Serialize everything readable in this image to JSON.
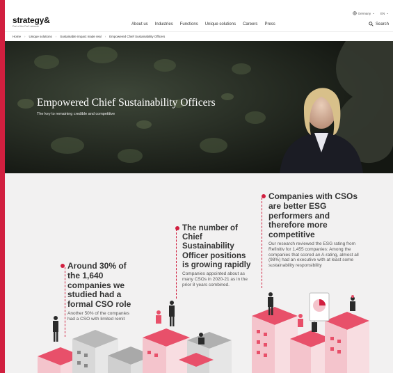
{
  "header": {
    "logo": "strategy&",
    "logo_tagline": "Part of the PwC network",
    "nav": [
      "About us",
      "Industries",
      "Functions",
      "Unique solutions",
      "Careers",
      "Press"
    ],
    "country": "Germany",
    "language": "EN",
    "search_label": "Search"
  },
  "breadcrumb": [
    "Home",
    "Unique solutions",
    "Sustainable impact made real",
    "Empowered Chief Sustainability Officers"
  ],
  "hero": {
    "title": "Empowered Chief Sustainability Officers",
    "subtitle": "The key to remaining credible and competitive"
  },
  "stats": [
    {
      "heading": "Around 30% of the 1,640 companies we studied had a formal CSO role",
      "body": "Another 50% of the companies had a CSO with limited remit"
    },
    {
      "heading": "The number of Chief Sustainability Officer positions is growing rapidly",
      "body": "Companies appointed about as many CSOs in 2020-21 as in the prior 8 years combined."
    },
    {
      "heading": "Companies with CSOs are better ESG performers and therefore more competitive",
      "body": "Our research reviewed the ESG rating from Refinitiv for 1,455 companies: Among the companies that scored an A-rating, almost all (98%) had an executive with at least some sustainability responsibility"
    }
  ],
  "colors": {
    "accent": "#d11f3f",
    "hero_bg": "#1e221c",
    "lower_bg": "#f2f1f1"
  }
}
